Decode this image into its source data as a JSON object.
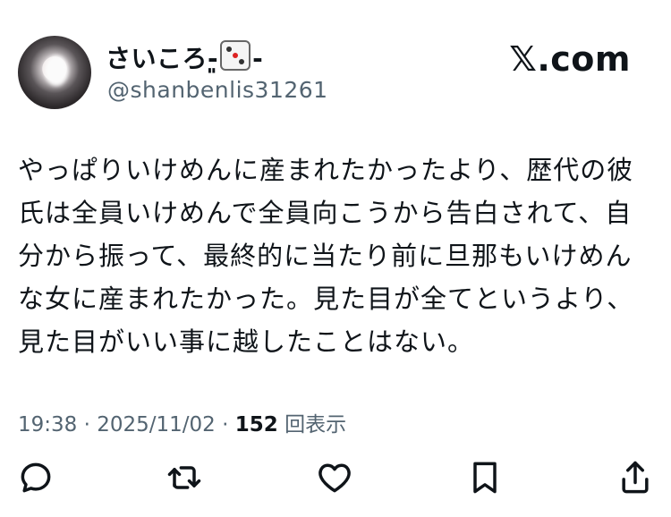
{
  "author": {
    "name_prefix": "さいころ-͈",
    "name_suffix": "-",
    "handle": "@shanbenlis31261"
  },
  "brand": {
    "label": "𝕏.com"
  },
  "tweet": {
    "lines": [
      "やっぱりいけめんに産まれたかったより、歴代の彼",
      "氏は全員いけめんで全員向こうから告白されて、自",
      "分から振って、最終的に当たり前に旦那もいけめん",
      "な女に産まれたかった。見た目が全てというより、",
      "見た目がいい事に越したことはない。"
    ]
  },
  "meta": {
    "time": "19:38",
    "separator": "·",
    "date": "2025/11/02",
    "views_count": "152",
    "views_label": "回表示"
  },
  "actions": [
    {
      "icon": "reply-icon"
    },
    {
      "icon": "retweet-icon"
    },
    {
      "icon": "like-icon"
    },
    {
      "icon": "bookmark-icon"
    },
    {
      "icon": "share-icon"
    }
  ]
}
